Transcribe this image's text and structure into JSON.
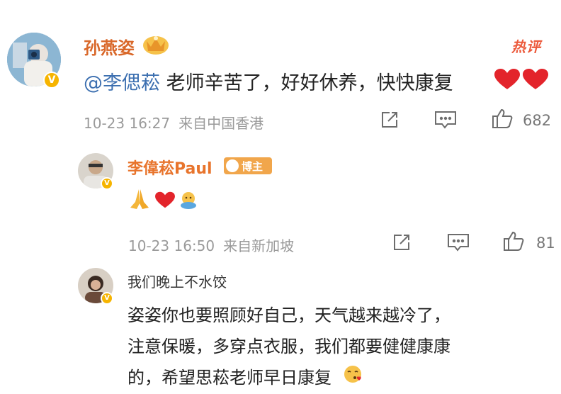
{
  "hot_tag": "热评",
  "comment": {
    "username": "孙燕姿",
    "mention": "@李偲菘",
    "text": " 老师辛苦了，好好休养，快快康复",
    "date": "10-23 16:27",
    "source": "来自中国香港",
    "likes": "682"
  },
  "reply1": {
    "username": "李偉菘Paul",
    "badge": "博主",
    "date": "10-23 16:50",
    "source": "来自新加坡",
    "likes": "81"
  },
  "reply2": {
    "username": "我们晚上不水饺",
    "lines": [
      "姿姿你也要照顾好自己，天气越来越冷了，",
      "注意保暖，多穿点衣服，我们都要健健康康",
      "的，希望思菘老师早日康复"
    ]
  },
  "icons": {
    "share": "share-icon",
    "comment": "comment-icon",
    "like": "thumbs-up-icon",
    "heart": "red-heart-emoji",
    "pray": "folded-hands-emoji",
    "verified": "verified-v-badge"
  },
  "colors": {
    "username": "#e8742c",
    "mention": "#3c6fb0",
    "meta": "#9a9a9a",
    "hot": "#ec5a3c"
  }
}
